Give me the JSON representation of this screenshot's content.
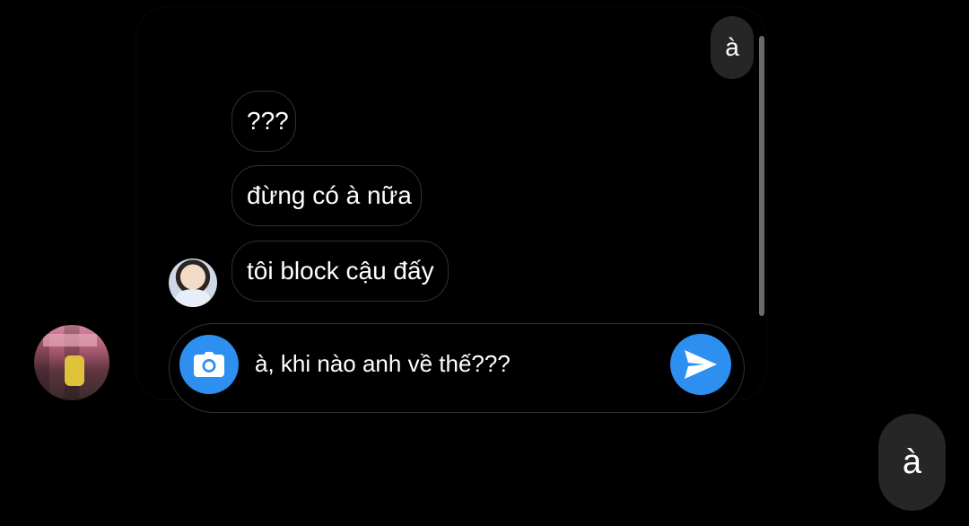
{
  "conversation": {
    "sent_top": "à",
    "received_messages": [
      {
        "text": "???"
      },
      {
        "text": "đừng có à nữa"
      },
      {
        "text": "tôi block cậu đấy"
      }
    ]
  },
  "composer": {
    "value": "à, khi nào anh về thế???",
    "camera_icon": "camera-icon",
    "send_icon": "send-icon"
  },
  "reply_bubble": "à",
  "colors": {
    "accent": "#2d8ff0",
    "bubble_border": "#2f2f2f",
    "sent_bubble": "#262626",
    "background": "#000000"
  }
}
